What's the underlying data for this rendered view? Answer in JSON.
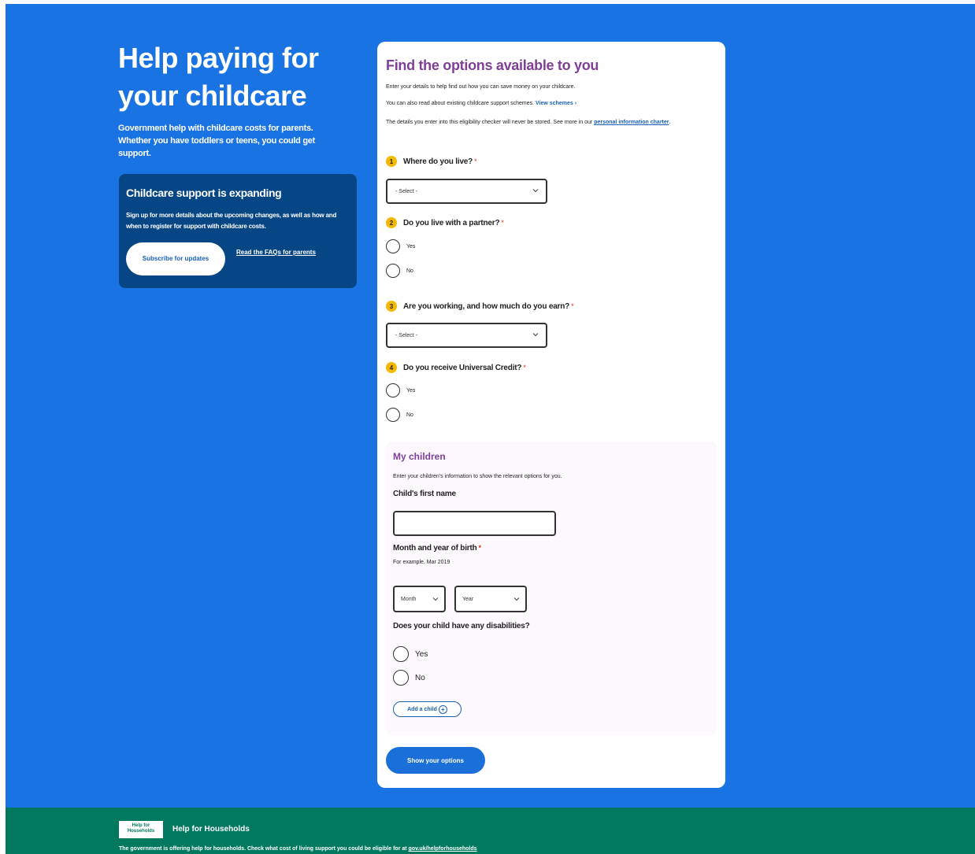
{
  "hero": {
    "title": "Help paying for your childcare",
    "subtitle": "Government help with childcare costs for parents. Whether you have toddlers or teens, you could get support."
  },
  "expanding_card": {
    "title": "Childcare support is expanding",
    "body": "Sign up for more details about the upcoming changes, as well as how and when to register for support with childcare costs.",
    "subscribe_label": "Subscribe for updates",
    "faq_label": "Read the FAQs for parents"
  },
  "form": {
    "title": "Find the options available to you",
    "intro": "Enter your details to help find out how you can save money on your childcare.",
    "schemes_text": "You can also read about existing childcare support schemes.",
    "schemes_link": "View schemes",
    "privacy_text": "The details you enter into this eligibility checker will never be stored. See more in our",
    "privacy_link": "personal information charter",
    "q1": {
      "number": "1",
      "label": "Where do you live?",
      "select_value": "- Select -"
    },
    "q2": {
      "number": "2",
      "label": "Do you live with a partner?",
      "yes": "Yes",
      "no": "No"
    },
    "q3": {
      "number": "3",
      "label": "Are you working, and how much do you earn?",
      "select_value": "- Select -"
    },
    "q4": {
      "number": "4",
      "label": "Do you receive Universal Credit?",
      "yes": "Yes",
      "no": "No"
    },
    "required_mark": "*",
    "children": {
      "title": "My children",
      "intro": "Enter your children's information to show the relevant options for you.",
      "first_name_label": "Child's first name",
      "first_name_value": "",
      "dob_label": "Month and year of birth",
      "dob_hint": "For example, Mar 2019",
      "month_value": "Month",
      "year_value": "Year",
      "disabilities_label": "Does your child have any disabilities?",
      "yes": "Yes",
      "no": "No",
      "add_child_label": "Add a child"
    },
    "show_button": "Show your options"
  },
  "footer": {
    "logo_text": "Help for Households",
    "name": "Help for Households",
    "text": "The government is offering help for households. Check what cost of living support you could be eligible for at",
    "link": "gov.uk/helpforhouseholds"
  },
  "colors": {
    "background": "#1a73e3",
    "card_dark": "#064685",
    "title_purple": "#7f3f98",
    "number_badge": "#f5b800",
    "footer_green": "#00795f",
    "button_blue": "#1a6fd9"
  }
}
